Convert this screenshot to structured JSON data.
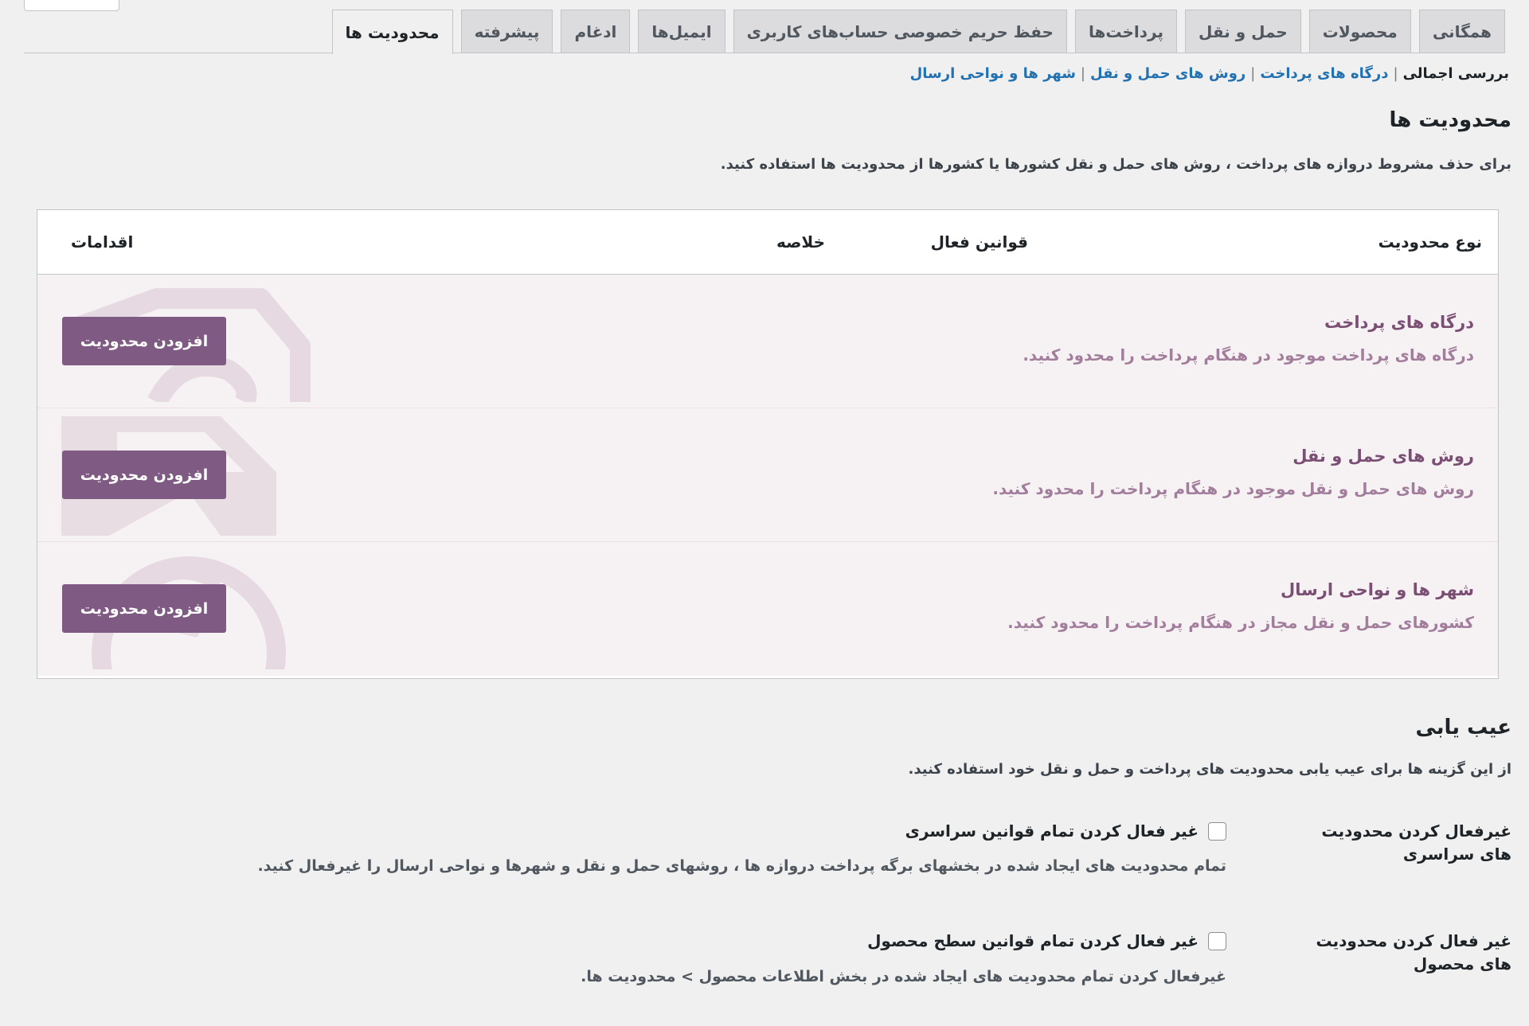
{
  "tabs": [
    {
      "label": "همگانی"
    },
    {
      "label": "محصولات"
    },
    {
      "label": "حمل و نقل"
    },
    {
      "label": "پرداخت‌ها"
    },
    {
      "label": "حفظ حریم خصوصی حساب‌های کاربری"
    },
    {
      "label": "ایمیل‌ها"
    },
    {
      "label": "ادغام"
    },
    {
      "label": "پیشرفته"
    },
    {
      "label": "محدودیت ها"
    }
  ],
  "active_tab": "محدودیت ها",
  "subnav": {
    "current": "بررسی اجمالی",
    "links": [
      "درگاه های پرداخت",
      "روش های حمل و نقل",
      "شهر ها و نواحی ارسال"
    ],
    "separator": "|"
  },
  "restrictions": {
    "title": "محدودیت ها",
    "description": "برای حذف مشروط دروازه های پرداخت ، روش های حمل و نقل کشورها یا کشورها از محدودیت ها استفاده کنید.",
    "table": {
      "headers": {
        "type": "نوع محدودیت",
        "active_rules": "قوانین فعال",
        "summary": "خلاصه",
        "actions": "اقدامات"
      },
      "rows": [
        {
          "title": "درگاه های پرداخت",
          "description": "درگاه های پرداخت موجود در هنگام پرداخت را محدود کنید.",
          "button": "افزودن محدودیت",
          "watermark_icon": "credit-card-icon"
        },
        {
          "title": "روش های حمل و نقل",
          "description": "روش های حمل و نقل موجود در هنگام پرداخت را محدود کنید.",
          "button": "افزودن محدودیت",
          "watermark_icon": "truck-icon"
        },
        {
          "title": "شهر ها و نواحی ارسال",
          "description": "کشورهای حمل و نقل مجاز در هنگام پرداخت را محدود کنید.",
          "button": "افزودن محدودیت",
          "watermark_icon": "globe-icon"
        }
      ]
    }
  },
  "troubleshooting": {
    "title": "عیب یابی",
    "description": "از این گزینه ها برای عیب یابی محدودیت های پرداخت و حمل و نقل خود استفاده کنید.",
    "options": [
      {
        "label": "غیرفعال کردن محدودیت های سراسری",
        "checkbox_label": "غیر فعال کردن تمام قوانین سراسری",
        "checked": false,
        "help": "تمام محدودیت های ایجاد شده در بخشهای برگه پرداخت دروازه ها ، روشهای حمل و نقل و شهرها و نواحی ارسال را غیرفعال کنید."
      },
      {
        "label": "غیر فعال کردن محدودیت های محصول",
        "checkbox_label": "غیر فعال کردن تمام قوانین سطح محصول",
        "checked": false,
        "help": "غیرفعال کردن تمام محدودیت های ایجاد شده در بخش اطلاعات محصول > محدودیت ها."
      }
    ]
  },
  "colors": {
    "accent_button": "#7f5a83",
    "row_title": "#7a4f73",
    "row_desc": "#a37e9c",
    "link": "#2271b1",
    "background": "#f0f0f1"
  }
}
